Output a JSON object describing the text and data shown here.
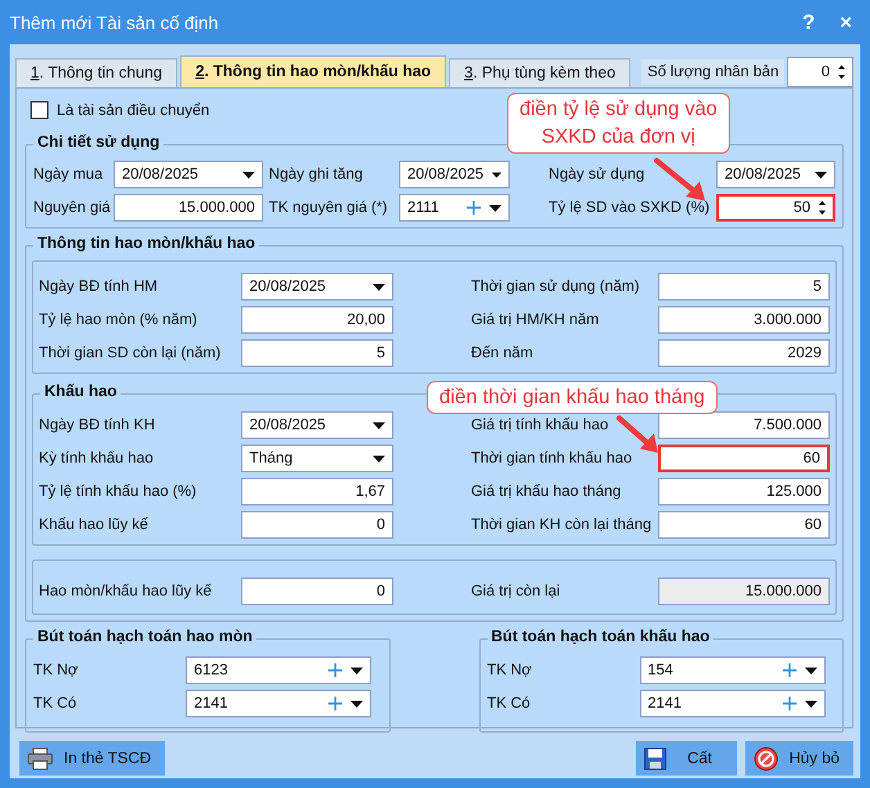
{
  "window": {
    "title": "Thêm mới Tài sản cố định",
    "help": "?",
    "close": "×"
  },
  "tabs": [
    {
      "label": "1. Thông tin chung",
      "selected": false
    },
    {
      "label": "2. Thông tin hao mòn/khấu hao",
      "selected": true
    },
    {
      "label": "3. Phụ tùng kèm theo",
      "selected": false
    }
  ],
  "copies": {
    "label": "Số lượng nhân bản",
    "value": "0"
  },
  "transfer_checkbox": {
    "label": "Là tài sản điều chuyển",
    "checked": false
  },
  "usage_details": {
    "title": "Chi tiết sử dụng",
    "fields": [
      {
        "label": "Ngày mua",
        "value": "20/08/2025",
        "kind": "date",
        "highlighted": false
      },
      {
        "label": "Ngày ghi tăng",
        "value": "20/08/2025",
        "kind": "date",
        "highlighted": false
      },
      {
        "label": "Ngày sử dụng",
        "value": "20/08/2025",
        "kind": "date",
        "highlighted": false
      },
      {
        "label": "Nguyên giá",
        "value": "15.000.000",
        "kind": "number",
        "highlighted": false
      },
      {
        "label": "TK nguyên giá (*)",
        "value": "2111",
        "kind": "account",
        "highlighted": false
      },
      {
        "label": "Tỷ lệ SD vào SXKD (%)",
        "value": "50",
        "kind": "spin",
        "highlighted": true
      }
    ]
  },
  "depreciation_info": {
    "title": "Thông tin hao mòn/khấu hao",
    "fields": [
      {
        "label": "Ngày BĐ tính HM",
        "value": "20/08/2025",
        "kind": "date",
        "highlighted": false
      },
      {
        "label": "Thời gian sử dụng (năm)",
        "value": "5",
        "kind": "number",
        "highlighted": false
      },
      {
        "label": "Tỷ lệ hao mòn (% năm)",
        "value": "20,00",
        "kind": "number",
        "highlighted": false
      },
      {
        "label": "Giá trị HM/KH năm",
        "value": "3.000.000",
        "kind": "number",
        "highlighted": false
      },
      {
        "label": "Thời gian SD còn lại (năm)",
        "value": "5",
        "kind": "number",
        "highlighted": false
      },
      {
        "label": "Đến năm",
        "value": "2029",
        "kind": "number",
        "highlighted": false
      }
    ]
  },
  "depreciation": {
    "title": "Khấu hao",
    "fields": [
      {
        "label": "Ngày BĐ tính KH",
        "value": "20/08/2025",
        "kind": "date",
        "highlighted": false
      },
      {
        "label": "Giá trị tính khấu hao",
        "value": "7.500.000",
        "kind": "number",
        "highlighted": false
      },
      {
        "label": "Kỳ tính khấu hao",
        "value": "Tháng",
        "kind": "select",
        "highlighted": false
      },
      {
        "label": "Thời gian tính khấu hao",
        "value": "60",
        "kind": "number",
        "highlighted": true
      },
      {
        "label": "Tỷ lệ tính khấu hao (%)",
        "value": "1,67",
        "kind": "number",
        "highlighted": false
      },
      {
        "label": "Giá trị khấu hao tháng",
        "value": "125.000",
        "kind": "number",
        "highlighted": false
      },
      {
        "label": "Khấu hao lũy kế",
        "value": "0",
        "kind": "number",
        "highlighted": false
      },
      {
        "label": "Thời gian KH còn lại tháng",
        "value": "60",
        "kind": "number",
        "highlighted": false
      }
    ]
  },
  "totals": {
    "fields": [
      {
        "label": "Hao mòn/khấu hao lũy kế",
        "value": "0",
        "kind": "number",
        "highlighted": false
      },
      {
        "label": "Giá trị còn lại",
        "value": "15.000.000",
        "kind": "readonly",
        "highlighted": false
      }
    ]
  },
  "journal_entries": [
    {
      "title": "Bút toán hạch toán hao mòn",
      "fields": [
        {
          "label": "TK Nợ",
          "value": "6123",
          "kind": "account",
          "highlighted": false
        },
        {
          "label": "TK Có",
          "value": "2141",
          "kind": "account",
          "highlighted": false
        }
      ]
    },
    {
      "title": "Bút toán hạch toán khấu hao",
      "fields": [
        {
          "label": "TK Nợ",
          "value": "154",
          "kind": "account",
          "highlighted": false
        },
        {
          "label": "TK Có",
          "value": "2141",
          "kind": "account",
          "highlighted": false
        }
      ]
    }
  ],
  "callouts": [
    {
      "text": "điền tỷ lệ sử dụng vào\nSXKD của đơn vị",
      "kind": "two-line"
    },
    {
      "text": "điền thời gian khấu hao tháng",
      "kind": "one-line"
    }
  ],
  "footer_buttons": [
    {
      "label": "In thẻ TSCĐ",
      "kind": "print"
    },
    {
      "label": "Cất",
      "kind": "save"
    },
    {
      "label": "Hủy bỏ",
      "kind": "cancel"
    }
  ]
}
